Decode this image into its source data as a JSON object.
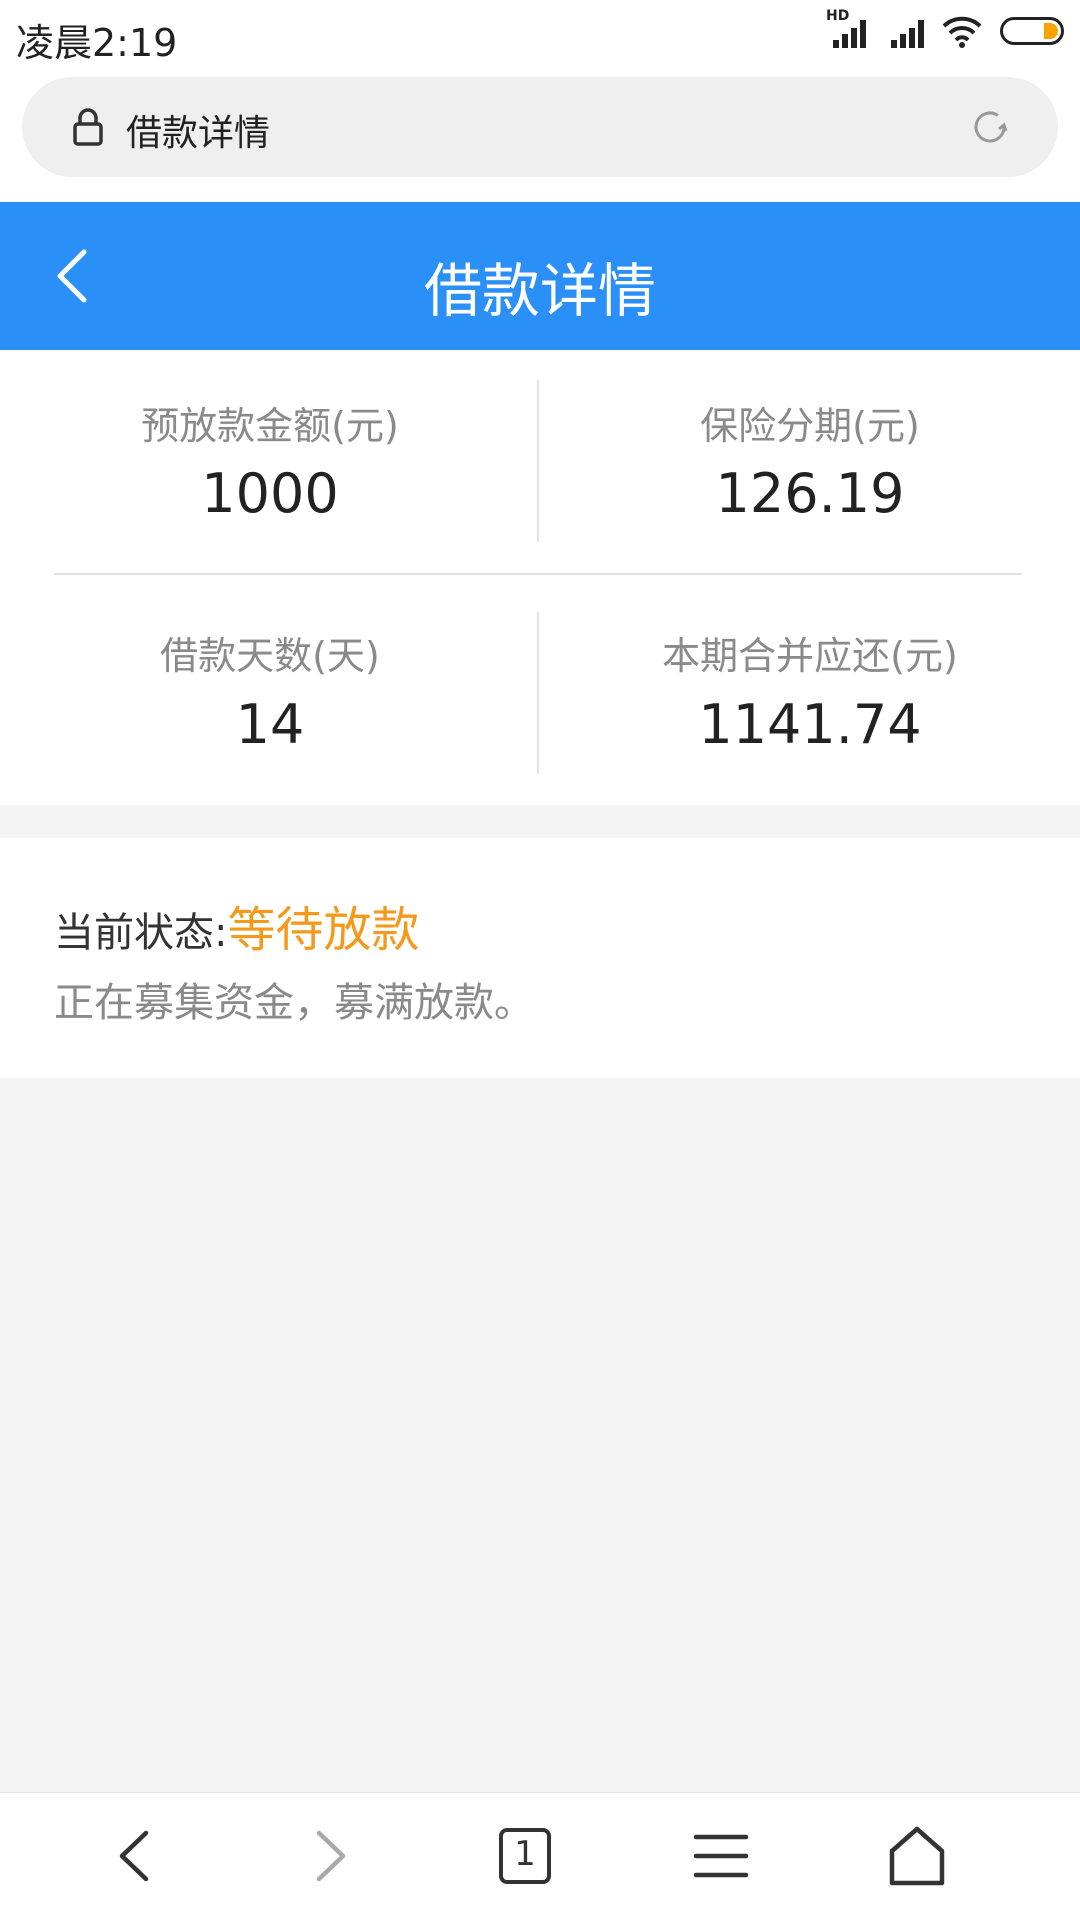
{
  "status_bar": {
    "time": "凌晨2:19",
    "network_badge": "HD",
    "battery_color": "#f7a400"
  },
  "address_bar": {
    "text": "借款详情",
    "lock_icon": "lock-icon",
    "reload_icon": "reload-icon"
  },
  "header": {
    "title": "借款详情",
    "back_icon": "chevron-left-icon",
    "color": "#2a8ff7"
  },
  "stats": [
    {
      "label": "预放款金额(元)",
      "value": "1000"
    },
    {
      "label": "保险分期(元)",
      "value": "126.19"
    },
    {
      "label": "借款天数(天)",
      "value": "14"
    },
    {
      "label": "本期合并应还(元)",
      "value": "1141.74"
    }
  ],
  "loan_status": {
    "label": "当前状态:",
    "value": "等待放款",
    "value_color": "#f39a1d",
    "description": "正在募集资金，募满放款。"
  },
  "bottom_nav": {
    "tab_count": "1",
    "icons": [
      "back-arrow-icon",
      "forward-arrow-icon",
      "tabs-icon",
      "menu-icon",
      "home-icon"
    ]
  }
}
